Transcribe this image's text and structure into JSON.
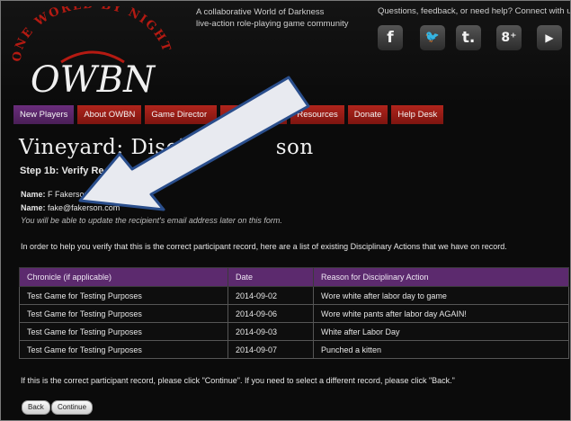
{
  "header": {
    "logo_text": "OWBN",
    "logo_arc_text": "ONE WORLD BY NIGHT",
    "tagline_line1": "A collaborative World of Darkness",
    "tagline_line2": "live-action role-playing game community",
    "contact_text": "Questions, feedback, or need help? Connect with us:",
    "social": [
      {
        "icon": "facebook-icon",
        "glyph": "f"
      },
      {
        "icon": "twitter-icon",
        "glyph": "🐦"
      },
      {
        "icon": "tumblr-icon",
        "glyph": "t."
      },
      {
        "icon": "google-plus-icon",
        "glyph": "8⁺"
      },
      {
        "icon": "youtube-icon",
        "glyph": "▶"
      }
    ]
  },
  "nav": {
    "items": [
      "New Players",
      "About OWBN",
      "Game Director",
      "",
      "Resources",
      "Donate",
      "Help Desk"
    ]
  },
  "page": {
    "title": "Vineyard: Discipli",
    "title_tail": "son",
    "step": "Step 1b: Verify Re",
    "name_label1": "Name:",
    "name_value1": "F Fakerson",
    "name_label2": "Name:",
    "name_value2": "fake@fakerson.com",
    "email_note": "You will be able to update the recipient's email address later on this form.",
    "intro": "In order to help you verify that this is the correct participant record, here are a list of existing Disciplinary Actions that we have on record.",
    "outro": "If this is the correct participant record, please click \"Continue\". If you need to select a different record, please click \"Back.\""
  },
  "table": {
    "headers": [
      "Chronicle (if applicable)",
      "Date",
      "Reason for Disciplinary Action"
    ],
    "rows": [
      [
        "Test Game for Testing Purposes",
        "2014-09-02",
        "Wore white after labor day to game"
      ],
      [
        "Test Game for Testing Purposes",
        "2014-09-06",
        "Wore white pants after labor day AGAIN!"
      ],
      [
        "Test Game for Testing Purposes",
        "2014-09-03",
        "White after Labor Day"
      ],
      [
        "Test Game for Testing Purposes",
        "2014-09-07",
        "Punched a kitten"
      ]
    ]
  },
  "buttons": {
    "back": "Back",
    "continue": "Continue"
  },
  "colors": {
    "nav_red": "#b0241c",
    "nav_purple": "#6a2d7c",
    "table_header": "#5c2a6e",
    "arrow": "#e8eaf0"
  }
}
